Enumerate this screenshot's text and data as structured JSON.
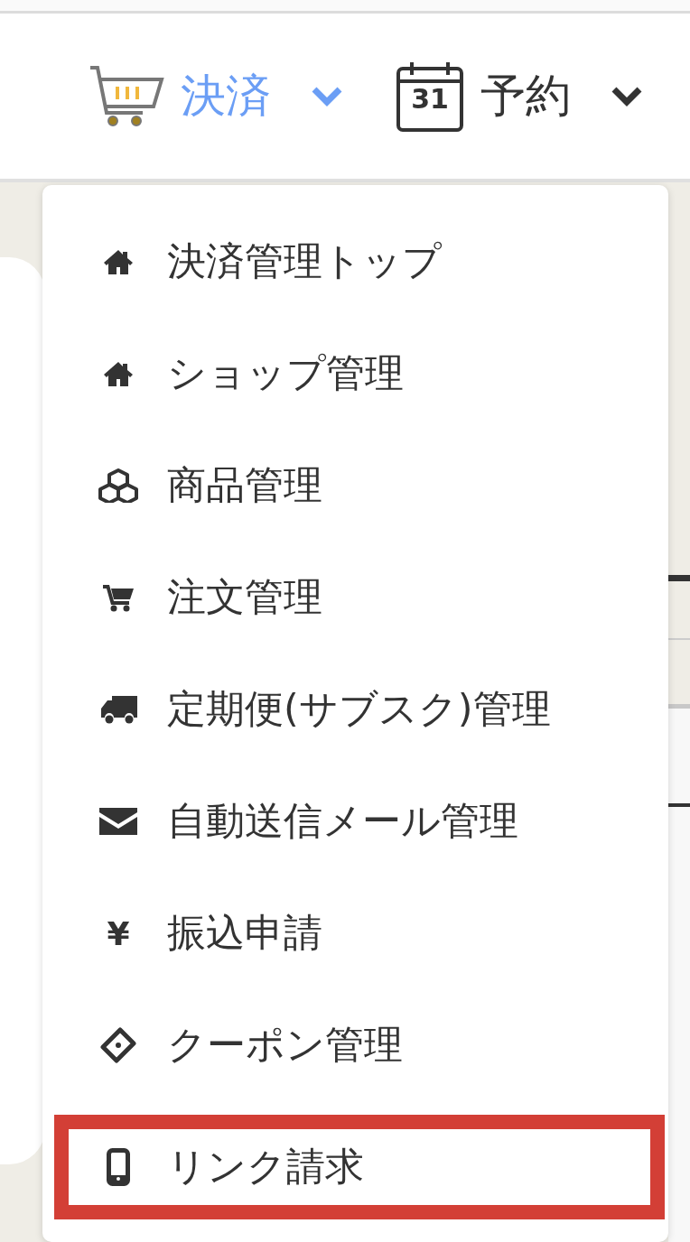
{
  "nav": [
    {
      "label": "決済",
      "kind": "cart",
      "active": true
    },
    {
      "label": "予約",
      "kind": "calendar",
      "icon_text": "31",
      "active": false
    }
  ],
  "menu": {
    "items": [
      {
        "label": "決済管理トップ",
        "kind": "home",
        "highlighted": false
      },
      {
        "label": "ショップ管理",
        "kind": "home",
        "highlighted": false
      },
      {
        "label": "商品管理",
        "kind": "boxes",
        "highlighted": false
      },
      {
        "label": "注文管理",
        "kind": "cart",
        "highlighted": false
      },
      {
        "label": "定期便(サブスク)管理",
        "kind": "truck",
        "highlighted": false
      },
      {
        "label": "自動送信メール管理",
        "kind": "envelope",
        "highlighted": false
      },
      {
        "label": "振込申請",
        "kind": "text",
        "icon_text": "¥",
        "highlighted": false
      },
      {
        "label": "クーポン管理",
        "kind": "tag",
        "highlighted": false
      },
      {
        "label": "リンク請求",
        "kind": "mobile",
        "highlighted": true
      }
    ]
  }
}
